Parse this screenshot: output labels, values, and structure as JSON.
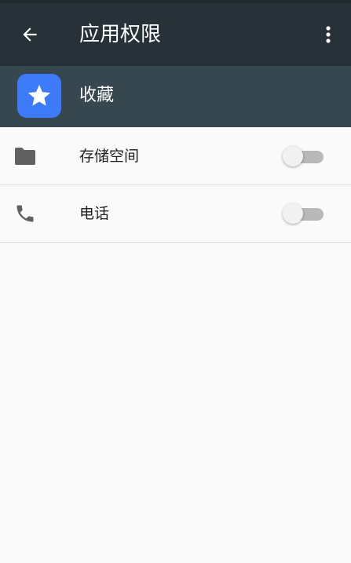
{
  "toolbar": {
    "title": "应用权限",
    "back_icon": "arrow-back-icon",
    "overflow_icon": "more-vert-icon",
    "background": "#263238"
  },
  "app": {
    "name": "收藏",
    "icon": "star-icon",
    "icon_color": "#3d7bfa",
    "header_background": "#37474f"
  },
  "permissions": [
    {
      "label": "存储空间",
      "icon": "folder-icon",
      "enabled": false
    },
    {
      "label": "电话",
      "icon": "phone-icon",
      "enabled": false
    }
  ]
}
